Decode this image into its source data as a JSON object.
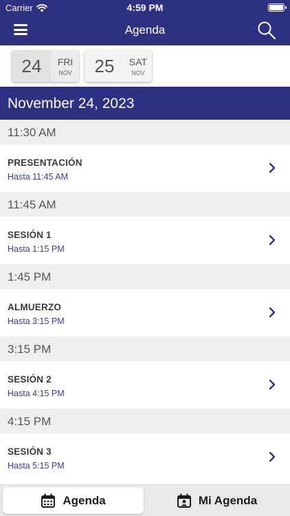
{
  "status_bar": {
    "carrier": "Carrier",
    "time": "4:59 PM"
  },
  "nav": {
    "title": "Agenda"
  },
  "dates": [
    {
      "day": "24",
      "weekday": "FRI",
      "month": "NOV",
      "selected": true
    },
    {
      "day": "25",
      "weekday": "SAT",
      "month": "NOV",
      "selected": false
    }
  ],
  "day_header": "November 24, 2023",
  "agenda": [
    {
      "time": "11:30 AM",
      "title": "PRESENTACIÓN",
      "until": "Hasta 11:45 AM"
    },
    {
      "time": "11:45 AM",
      "title": "SESIÓN 1",
      "until": "Hasta 1:15 PM"
    },
    {
      "time": "1:45 PM",
      "title": "ALMUERZO",
      "until": "Hasta 3:15 PM"
    },
    {
      "time": "3:15 PM",
      "title": "SESIÓN 2",
      "until": "Hasta 4:15 PM"
    },
    {
      "time": "4:15 PM",
      "title": "SESIÓN 3",
      "until": "Hasta 5:15 PM"
    }
  ],
  "tabs": [
    {
      "label": "Agenda",
      "icon": "calendar-icon",
      "active": true
    },
    {
      "label": "Mi Agenda",
      "icon": "personal-calendar-icon",
      "active": false
    }
  ],
  "colors": {
    "brand": "#2e3182",
    "accent_text": "#3b3e8c",
    "time_row_bg": "#efefef"
  }
}
